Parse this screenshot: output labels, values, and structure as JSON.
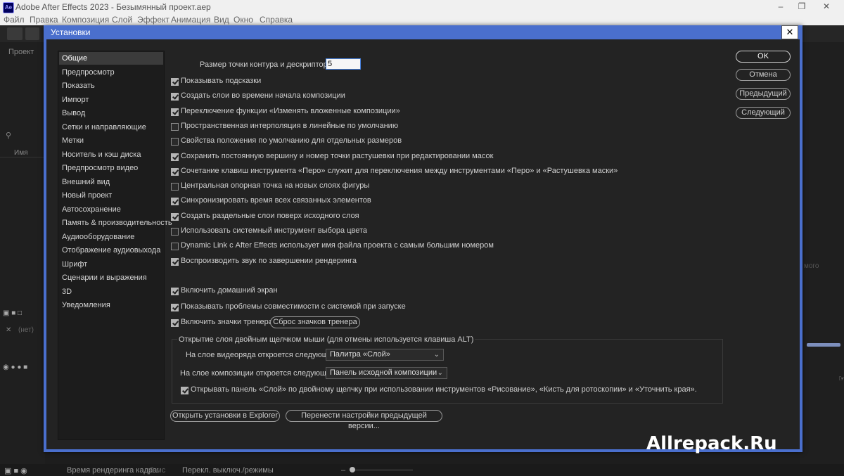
{
  "window": {
    "app_badge": "Ae",
    "title": "Adobe After Effects 2023 - Безымянный проект.aep"
  },
  "menubar": [
    "Файл",
    "Правка",
    "Композиция",
    "Слой",
    "Эффект",
    "Анимация",
    "Вид",
    "Окно",
    "Справка"
  ],
  "background": {
    "project_tab": "Проект",
    "name_column": "Имя",
    "layer_none": "(нет)",
    "right_fragment": "мого",
    "status_render_label": "Время рендеринга кадра:",
    "status_render_value": "0 мс",
    "status_switches": "Перекл. выключ./режимы"
  },
  "dialog": {
    "title": "Установки",
    "nav": [
      "Общие",
      "Предпросмотр",
      "Показать",
      "Импорт",
      "Вывод",
      "Сетки и направляющие",
      "Метки",
      "Носитель и кэш диска",
      "Предпросмотр видео",
      "Внешний вид",
      "Новый проект",
      "Автосохранение",
      "Память & производительность",
      "Аудиооборудование",
      "Отображение аудиовыхода",
      "Шрифт",
      "Сценарии и выражения",
      "3D",
      "Уведомления"
    ],
    "selected_nav": "Общие",
    "size_label": "Размер точки контура и дескриптора:",
    "size_value": "5",
    "options": [
      {
        "label": "Показывать подсказки",
        "checked": true
      },
      {
        "label": "Создать слои во времени начала композиции",
        "checked": true
      },
      {
        "label": "Переключение функции «Изменять вложенные композиции»",
        "checked": true
      },
      {
        "label": "Пространственная интерполяция в линейные по умолчанию",
        "checked": false
      },
      {
        "label": "Свойства положения по умолчанию для отдельных размеров",
        "checked": false
      },
      {
        "label": "Сохранить постоянную вершину и номер точки растушевки при редактировании масок",
        "checked": true
      },
      {
        "label": "Сочетание клавиш инструмента «Перо» служит для переключения между инструментами «Перо» и «Растушевка маски»",
        "checked": true
      },
      {
        "label": "Центральная опорная точка на новых слоях фигуры",
        "checked": false
      },
      {
        "label": "Синхронизировать время всех связанных элементов",
        "checked": true
      },
      {
        "label": "Создать раздельные слои поверх исходного слоя",
        "checked": true
      },
      {
        "label": "Использовать системный инструмент выбора цвета",
        "checked": false
      },
      {
        "label": "Dynamic Link с After Effects использует имя файла проекта с самым большим номером",
        "checked": false
      },
      {
        "label": "Воспроизводить звук по завершении рендеринга",
        "checked": true
      }
    ],
    "options2": [
      {
        "label": "Включить домашний экран",
        "checked": true
      },
      {
        "label": "Показывать проблемы совместимости с системой при запуске",
        "checked": true
      },
      {
        "label": "Включить значки тренера",
        "checked": true
      }
    ],
    "reset_trainer_button": "Сброс значков тренера",
    "group": {
      "title": "Открытие слоя двойным щелчком мыши (для отмены используется клавиша ALT)",
      "video_label": "На слое видеоряда откроется следующее:",
      "video_value": "Палитра «Слой»",
      "comp_label": "На слое композиции откроется следующее:",
      "comp_value": "Панель исходной композиции",
      "paint_label": "Открывать панель «Слой» по двойному щелчку при использовании инструментов «Рисование», «Кисть для ротоскопии» и «Уточнить края».",
      "paint_checked": true
    },
    "open_explorer_button": "Открыть установки в Explorer",
    "migrate_button": "Перенести настройки предыдущей версии...",
    "buttons": {
      "ok": "OK",
      "cancel": "Отмена",
      "prev": "Предыдущий",
      "next": "Следующий"
    }
  },
  "watermark": "Allrepack.Ru"
}
